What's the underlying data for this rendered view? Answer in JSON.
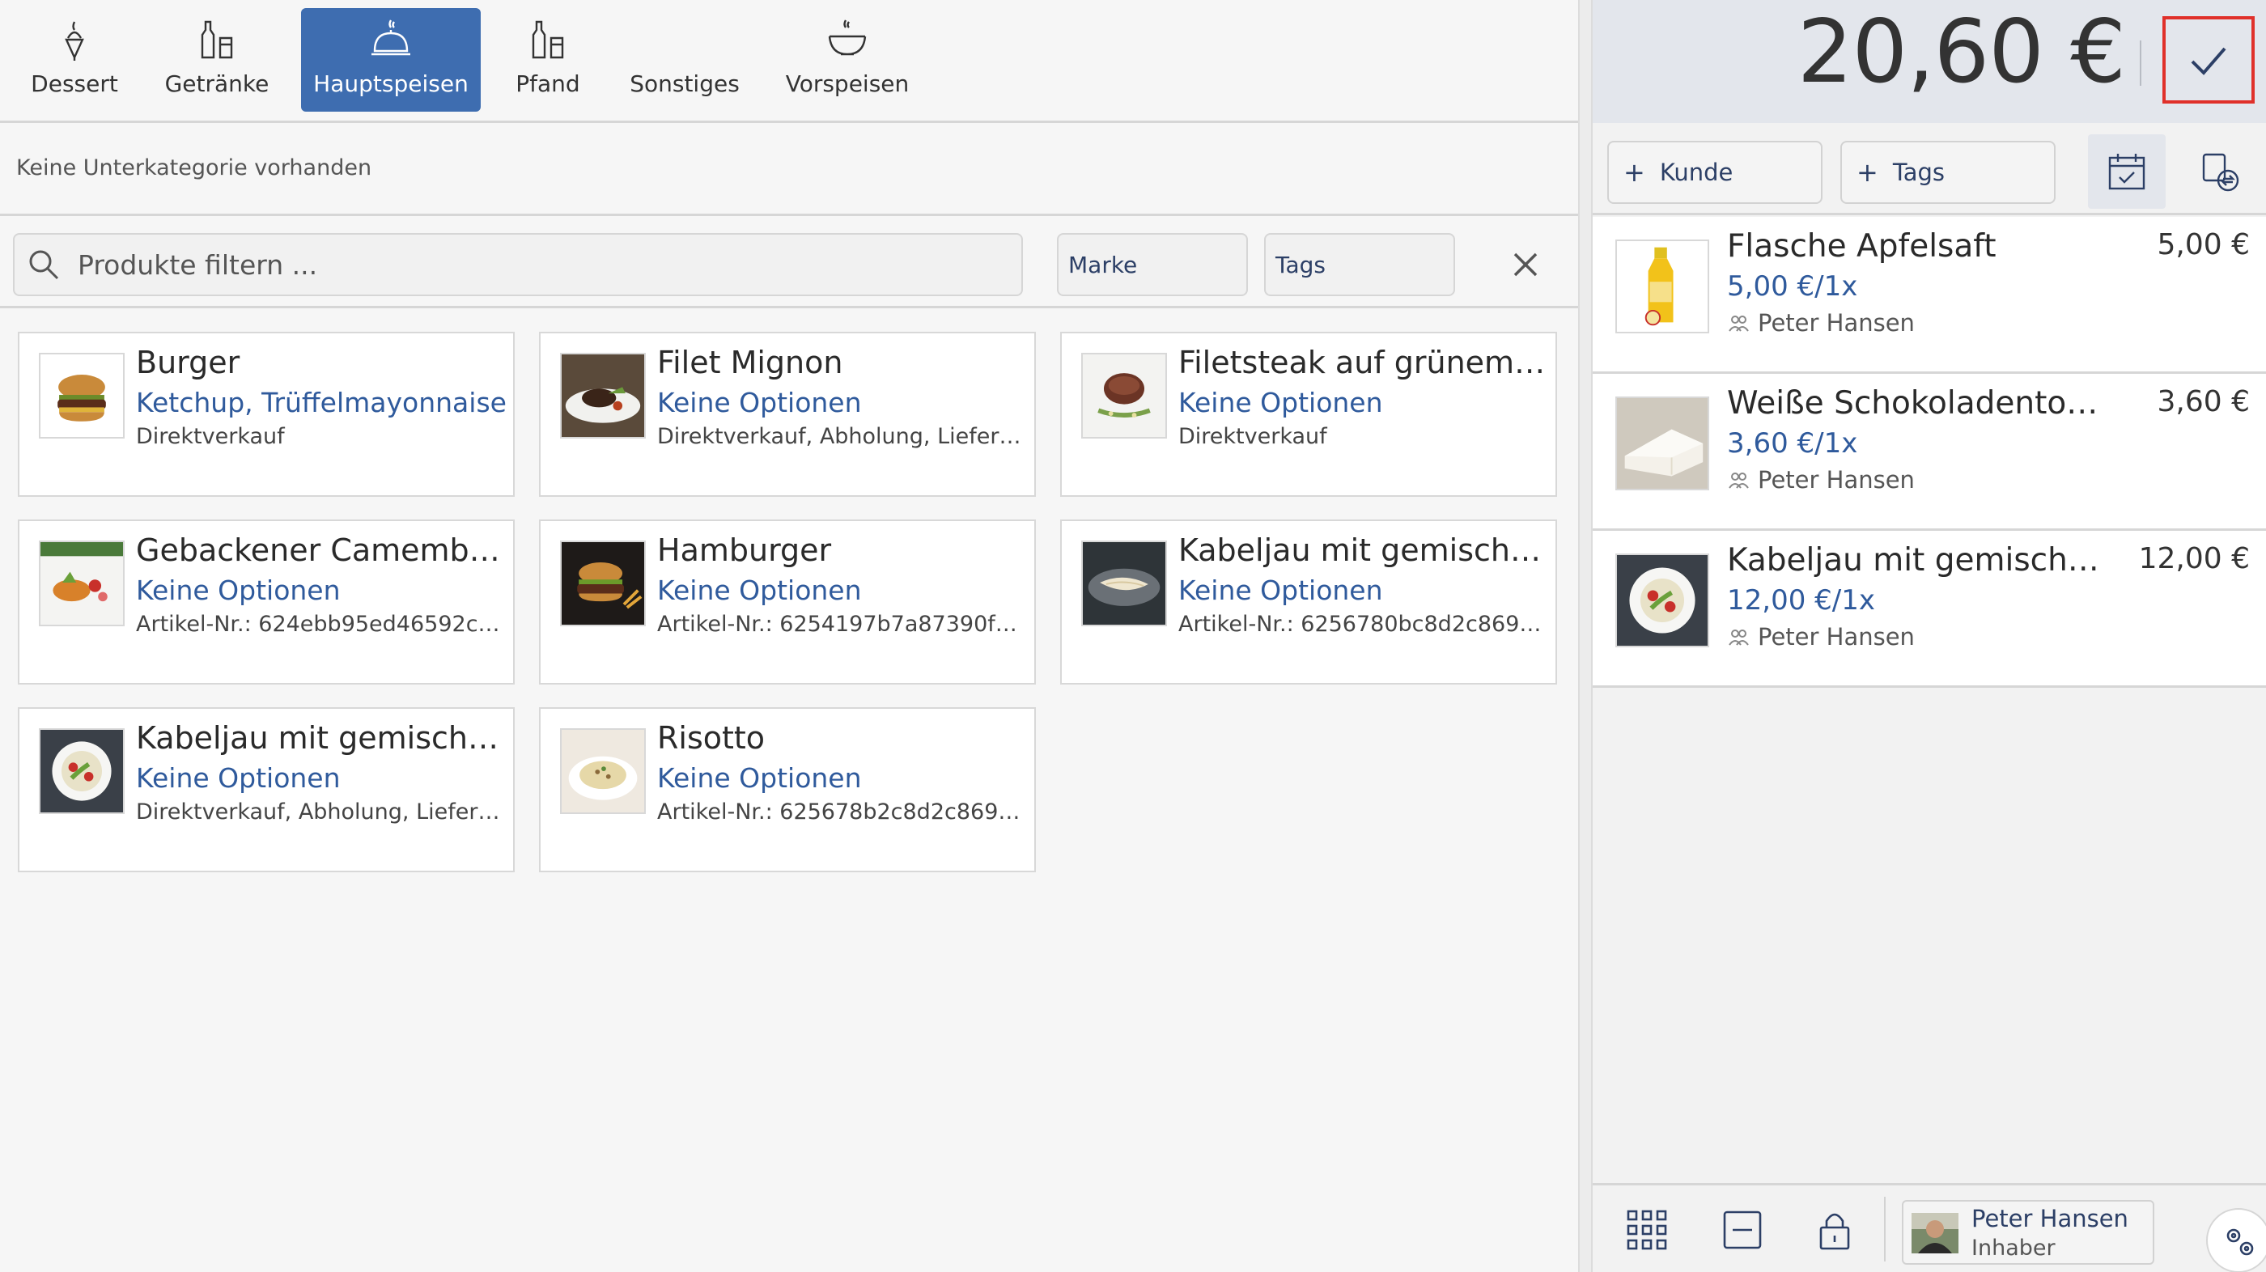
{
  "categories": [
    {
      "label": "Dessert",
      "icon": "ice-cream-icon"
    },
    {
      "label": "Getränke",
      "icon": "bottles-icon"
    },
    {
      "label": "Hauptspeisen",
      "icon": "cloche-icon",
      "active": true
    },
    {
      "label": "Pfand",
      "icon": "bottles-icon"
    },
    {
      "label": "Sonstiges",
      "icon": "none"
    },
    {
      "label": "Vorspeisen",
      "icon": "bowl-icon"
    }
  ],
  "subcategory_text": "Keine Unterkategorie vorhanden",
  "search": {
    "placeholder": "Produkte filtern ...",
    "value": ""
  },
  "filters": {
    "brand_label": "Marke",
    "tags_label": "Tags"
  },
  "products": [
    {
      "name": "Burger",
      "options": "Ketchup, Trüffelmayonnaise",
      "meta": "Direktverkauf",
      "image": "burger-image"
    },
    {
      "name": "Filet Mignon",
      "options": "Keine Optionen",
      "meta": "Direktverkauf, Abholung, Lieferung",
      "image": "steak-plate-image"
    },
    {
      "name": "Filetsteak auf grünem Sp...",
      "options": "Keine Optionen",
      "meta": "Direktverkauf",
      "image": "filetsteak-image"
    },
    {
      "name": "Gebackener Camembert",
      "options": "Keine Optionen",
      "meta": "Artikel-Nr.: 624ebb95ed46592ce2...",
      "image": "camembert-image"
    },
    {
      "name": "Hamburger",
      "options": "Keine Optionen",
      "meta": "Artikel-Nr.: 6254197b7a87390f37...",
      "image": "hamburger-image"
    },
    {
      "name": "Kabeljau mit gemischte...",
      "options": "Keine Optionen",
      "meta": "Artikel-Nr.: 6256780bc8d2c86988...",
      "image": "cod-dark-image"
    },
    {
      "name": "Kabeljau mit gemischte...",
      "options": "Keine Optionen",
      "meta": "Direktverkauf, Abholung, Lieferung",
      "image": "cod-salad-image"
    },
    {
      "name": "Risotto",
      "options": "Keine Optionen",
      "meta": "Artikel-Nr.: 625678b2c8d2c86988...",
      "image": "risotto-image"
    }
  ],
  "order": {
    "total": "20,60 €",
    "add_customer_label": "Kunde",
    "add_tags_label": "Tags",
    "items": [
      {
        "name": "Flasche Apfelsaft",
        "price": "5,00 €",
        "unit": "5,00 €/1x",
        "staff": "Peter Hansen",
        "image": "apple-juice-image"
      },
      {
        "name": "Weiße Schokoladentorte",
        "price": "3,60 €",
        "unit": "3,60 €/1x",
        "staff": "Peter Hansen",
        "image": "cake-image"
      },
      {
        "name": "Kabeljau mit gemischtem...",
        "price": "12,00 €",
        "unit": "12,00 €/1x",
        "staff": "Peter Hansen",
        "image": "cod-salad-image"
      }
    ]
  },
  "user": {
    "name": "Peter Hansen",
    "role": "Inhaber"
  },
  "colors": {
    "accent": "#3e6db0",
    "link": "#2f5a9c",
    "confirm_outline": "#e0302a"
  }
}
